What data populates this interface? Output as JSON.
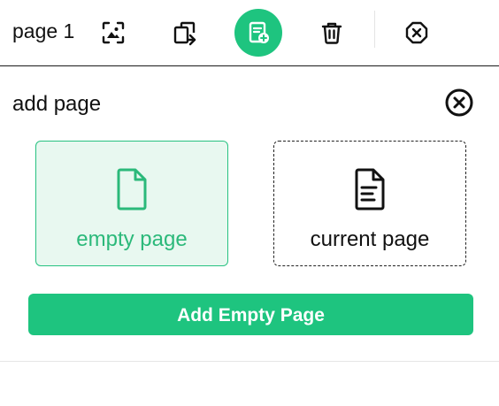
{
  "toolbar": {
    "page_label": "page 1",
    "icons": {
      "image": "image-frame-icon",
      "swap": "swap-pages-icon",
      "add_page": "add-page-icon",
      "delete": "trash-icon",
      "close": "close-octagon-icon"
    },
    "active_color": "#1ec47f"
  },
  "panel": {
    "title": "add page",
    "options": [
      {
        "label": "empty page",
        "icon": "blank-page-icon",
        "selected": true
      },
      {
        "label": "current page",
        "icon": "text-page-icon",
        "selected": false
      }
    ],
    "add_button_label": "Add Empty Page",
    "accent_color": "#1ec47f"
  }
}
